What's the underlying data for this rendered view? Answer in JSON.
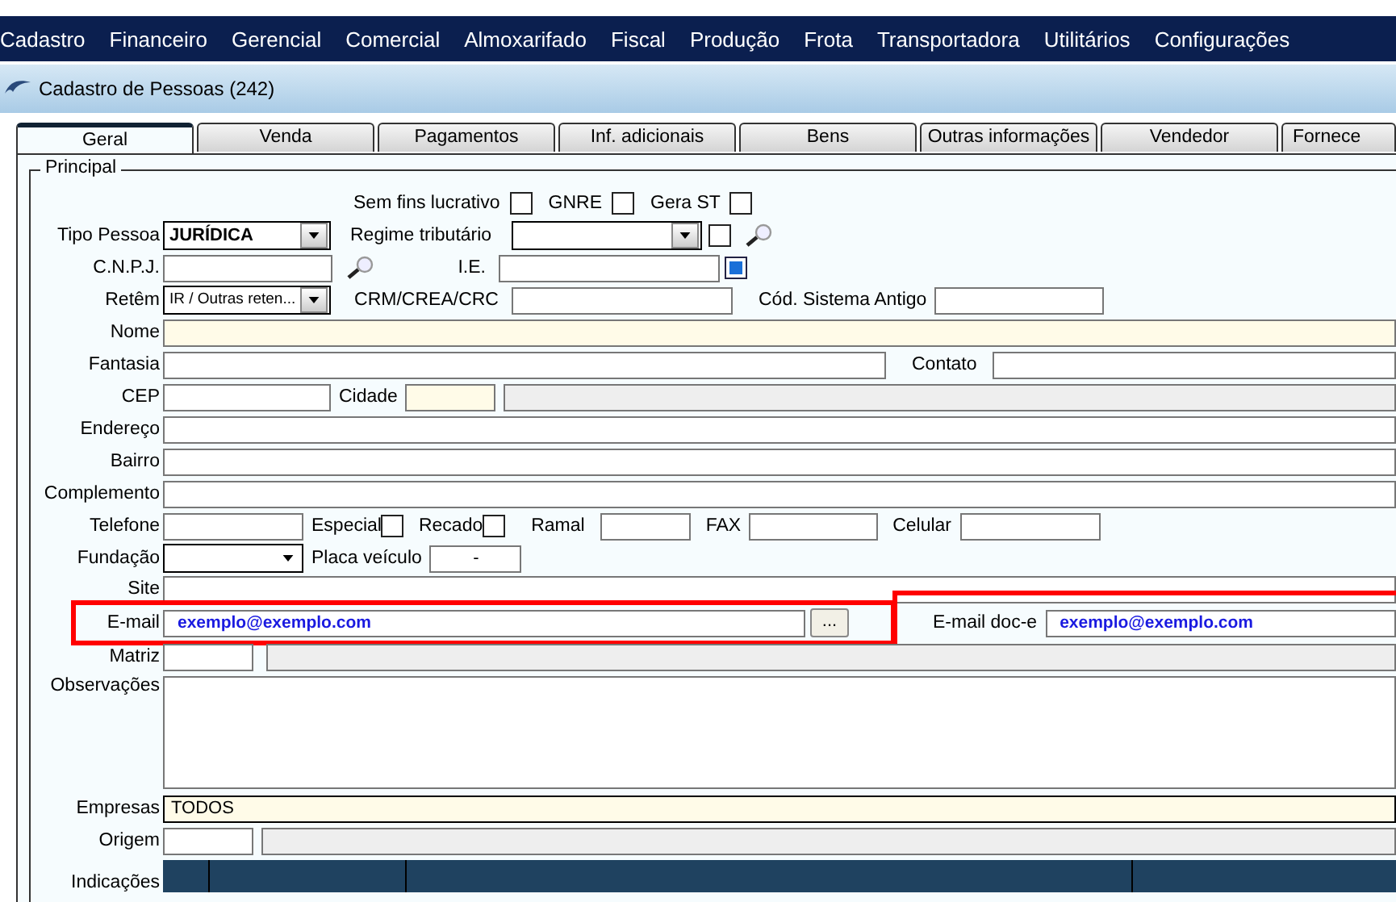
{
  "menu": [
    {
      "label": "Cadastro"
    },
    {
      "label": "Financeiro"
    },
    {
      "label": "Gerencial"
    },
    {
      "label": "Comercial"
    },
    {
      "label": "Almoxarifado"
    },
    {
      "label": "Fiscal"
    },
    {
      "label": "Produção"
    },
    {
      "label": "Frota"
    },
    {
      "label": "Transportadora"
    },
    {
      "label": "Utilitários"
    },
    {
      "label": "Configurações"
    }
  ],
  "window": {
    "title": "Cadastro de Pessoas (242)"
  },
  "tabs": [
    {
      "label": "Geral",
      "selected": true
    },
    {
      "label": "Venda",
      "selected": false
    },
    {
      "label": "Pagamentos",
      "selected": false
    },
    {
      "label": "Inf. adicionais",
      "selected": false
    },
    {
      "label": "Bens",
      "selected": false
    },
    {
      "label": "Outras informações",
      "selected": false
    },
    {
      "label": "Vendedor",
      "selected": false
    },
    {
      "label": "Fornece",
      "selected": false
    }
  ],
  "group": {
    "title": "Principal"
  },
  "form": {
    "sem_fins": {
      "label": "Sem fins lucrativo",
      "checked": false
    },
    "gnre": {
      "label": "GNRE",
      "checked": false
    },
    "gera_st": {
      "label": "Gera ST",
      "checked": false
    },
    "tipo_pessoa": {
      "label": "Tipo Pessoa",
      "value": "JURÍDICA"
    },
    "regime": {
      "label": "Regime tributário",
      "checked": false
    },
    "cnpj": {
      "label": "C.N.P.J."
    },
    "ie": {
      "label": "I.E."
    },
    "retem": {
      "label": "Retêm",
      "value": "IR / Outras reten..."
    },
    "crm": {
      "label": "CRM/CREA/CRC"
    },
    "cod_antigo": {
      "label": "Cód. Sistema Antigo"
    },
    "nome": {
      "label": "Nome"
    },
    "fantasia": {
      "label": "Fantasia"
    },
    "contato": {
      "label": "Contato"
    },
    "cep": {
      "label": "CEP"
    },
    "cidade": {
      "label": "Cidade"
    },
    "endereco": {
      "label": "Endereço"
    },
    "bairro": {
      "label": "Bairro"
    },
    "complemento": {
      "label": "Complemento"
    },
    "telefone": {
      "label": "Telefone"
    },
    "especial": {
      "label": "Especial",
      "checked": false
    },
    "recado": {
      "label": "Recado",
      "checked": false
    },
    "ramal": {
      "label": "Ramal"
    },
    "fax": {
      "label": "FAX"
    },
    "celular": {
      "label": "Celular"
    },
    "fundacao": {
      "label": "Fundação"
    },
    "placa": {
      "label": "Placa veículo",
      "value": "-"
    },
    "site": {
      "label": "Site"
    },
    "email": {
      "label": "E-mail",
      "value": "exemplo@exemplo.com",
      "button": "...",
      "highlighted": true
    },
    "email_doc": {
      "label": "E-mail doc-e",
      "value": "exemplo@exemplo.com",
      "highlighted": true
    },
    "matriz": {
      "label": "Matriz"
    },
    "observacoes": {
      "label": "Observações"
    },
    "empresas": {
      "label": "Empresas",
      "value": "TODOS"
    },
    "origem": {
      "label": "Origem"
    },
    "indicacoes": {
      "label": "Indicações"
    }
  }
}
